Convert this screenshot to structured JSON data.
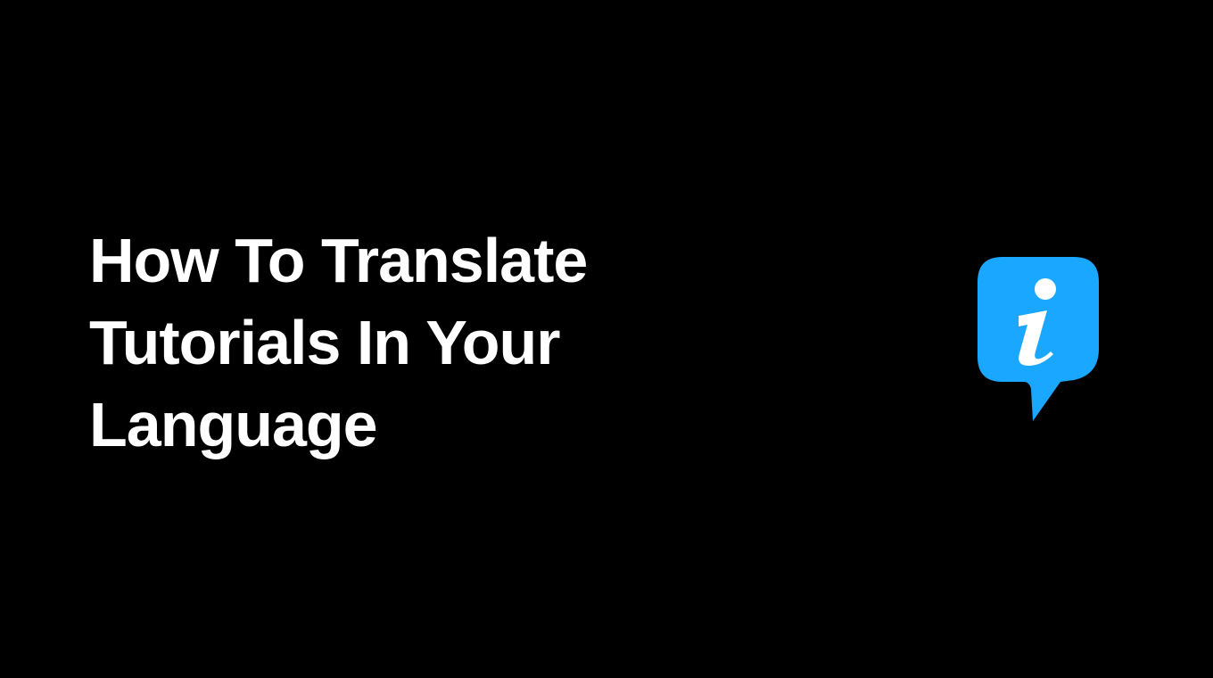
{
  "title_lines": [
    "How To Translate",
    "Tutorials In Your",
    "Language"
  ],
  "icon": {
    "name": "info-speech-bubble",
    "color": "#1AA7FF",
    "glyph": "i"
  },
  "colors": {
    "background": "#000000",
    "text": "#FFFFFF",
    "accent": "#1AA7FF"
  }
}
